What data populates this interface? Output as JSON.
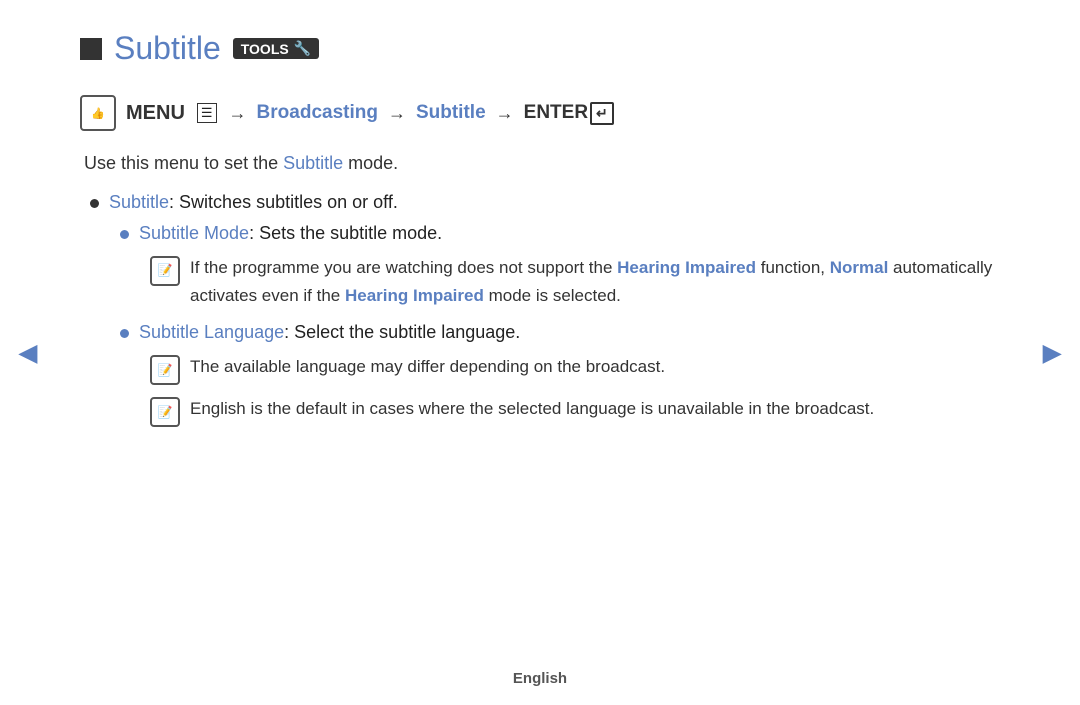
{
  "title": {
    "square_label": "■",
    "text": "Subtitle",
    "tools_badge": "TOOLS",
    "tools_icon": "🔧"
  },
  "nav": {
    "menu_icon_text": "m",
    "menu_label": "MENU",
    "menu_symbol": "㊗",
    "arrow": "→",
    "broadcasting": "Broadcasting",
    "subtitle": "Subtitle",
    "enter_label": "ENTER",
    "enter_icon": "↵"
  },
  "description": {
    "text_before": "Use this menu to set the ",
    "subtitle_link": "Subtitle",
    "text_after": " mode."
  },
  "bullets": [
    {
      "label": "Subtitle",
      "text": ": Switches subtitles on or off."
    }
  ],
  "nested_bullet": {
    "label": "Subtitle Mode",
    "text": ": Sets the subtitle mode."
  },
  "note1": {
    "text_before": "If the programme you are watching does not support the ",
    "hearing_impaired": "Hearing Impaired",
    "text_middle": " function, ",
    "normal": "Normal",
    "text_after": " automatically activates even if the ",
    "hearing_impaired2": "Hearing Impaired",
    "text_end": " mode is selected."
  },
  "subtitle_language_bullet": {
    "label": "Subtitle Language",
    "text": ": Select the subtitle language."
  },
  "note2": {
    "text": "The available language may differ depending on the broadcast."
  },
  "note3": {
    "text_before": "English is the default in cases where the selected language is unavailable in the broadcast."
  },
  "footer": {
    "language": "English"
  },
  "nav_arrows": {
    "prev": "◄",
    "next": "►"
  }
}
